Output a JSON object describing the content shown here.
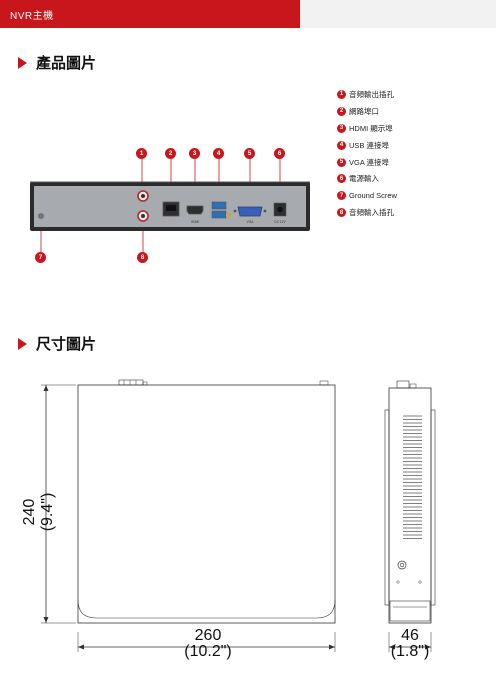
{
  "header": {
    "category": "NVR主機"
  },
  "sections": {
    "product_photo": "產品圖片",
    "dimension_drawing": "尺寸圖片"
  },
  "ports": [
    {
      "num": "1",
      "label": "音頻輸出插孔"
    },
    {
      "num": "2",
      "label": "網路埠口"
    },
    {
      "num": "3",
      "label": "HDMI 顯示埠"
    },
    {
      "num": "4",
      "label": "USB 連接埠"
    },
    {
      "num": "5",
      "label": "VGA 連接埠"
    },
    {
      "num": "6",
      "label": "電源輸入"
    },
    {
      "num": "7",
      "label": "Ground Screw"
    },
    {
      "num": "8",
      "label": "音頻輸入插孔"
    }
  ],
  "panel_markings": {
    "hdmi": "HDMI",
    "vga": "VGA",
    "dc": "DC 12V"
  },
  "dimensions": {
    "height": {
      "mm": "240",
      "inch": "(9.4\")"
    },
    "width": {
      "mm": "260",
      "inch": "(10.2\")"
    },
    "depth": {
      "mm": "46",
      "inch": "(1.8\")"
    }
  },
  "colors": {
    "accent": "#c8161d",
    "header_bg": "#f2f2f2"
  }
}
